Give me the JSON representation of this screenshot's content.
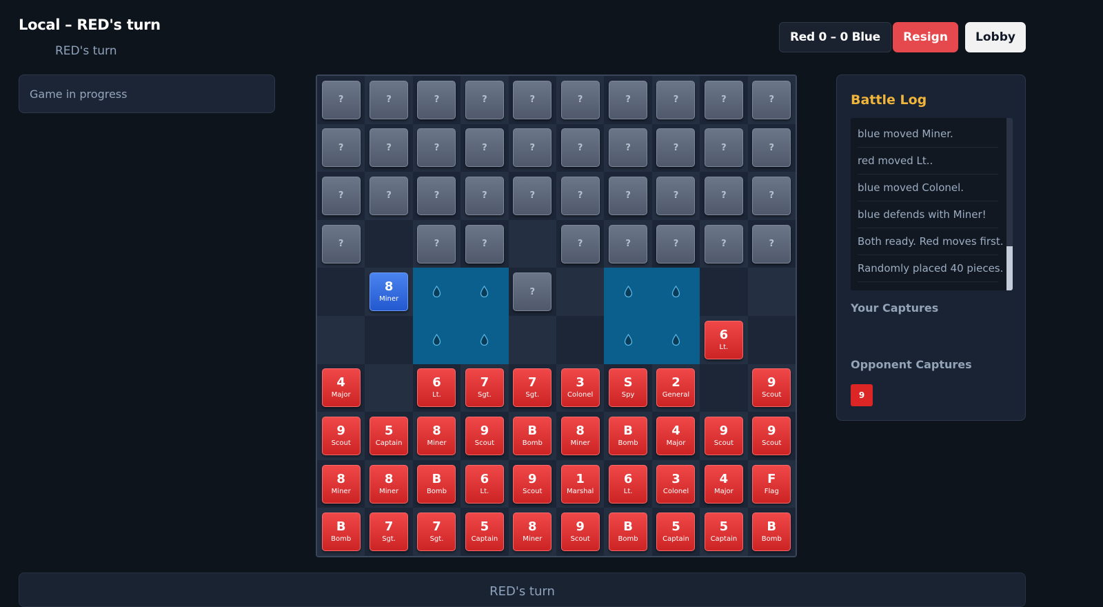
{
  "header": {
    "title": "Local – RED's turn",
    "subtitle": "RED's turn",
    "score": "Red 0 – 0 Blue",
    "resign_label": "Resign",
    "lobby_label": "Lobby"
  },
  "status": {
    "text": "Game in progress"
  },
  "colors": {
    "red_piece": "#e53935",
    "blue_piece": "#3b6fe0",
    "hidden_piece": "#5a6578",
    "lake": "#0b5f8c",
    "log_title": "#f0b53a",
    "resign": "#e5484d"
  },
  "board": {
    "hidden_label": "?",
    "lake_icon": "water-drop-icon",
    "rows": [
      [
        "?",
        "?",
        "?",
        "?",
        "?",
        "?",
        "?",
        "?",
        "?",
        "?"
      ],
      [
        "?",
        "?",
        "?",
        "?",
        "?",
        "?",
        "?",
        "?",
        "?",
        "?"
      ],
      [
        "?",
        "?",
        "?",
        "?",
        "?",
        "?",
        "?",
        "?",
        "?",
        "?"
      ],
      [
        "?",
        "",
        "?",
        "?",
        "",
        "?",
        "?",
        "?",
        "?",
        "?"
      ],
      [
        "",
        "B8",
        "~",
        "~",
        "?",
        "",
        "~",
        "~",
        "",
        ""
      ],
      [
        "",
        "",
        "~",
        "~",
        "",
        "",
        "~",
        "~",
        "R6",
        ""
      ],
      [
        "R4",
        "",
        "R6",
        "R7",
        "R7",
        "R3",
        "RS",
        "R2",
        "",
        "R9"
      ],
      [
        "R9",
        "R5",
        "R8",
        "R9",
        "RB",
        "R8",
        "RB",
        "R4",
        "R9",
        "R9"
      ],
      [
        "R8",
        "R8",
        "RB",
        "R6",
        "R9",
        "R1",
        "R6",
        "R3",
        "R4",
        "RF"
      ],
      [
        "RB",
        "R7",
        "R7",
        "R5",
        "R8",
        "R9",
        "RB",
        "R5",
        "R5",
        "RB"
      ]
    ],
    "rank_names": {
      "1": "Marshal",
      "2": "General",
      "3": "Colonel",
      "4": "Major",
      "5": "Captain",
      "6": "Lt.",
      "7": "Sgt.",
      "8": "Miner",
      "9": "Scout",
      "S": "Spy",
      "B": "Bomb",
      "F": "Flag"
    }
  },
  "battle_log": {
    "title": "Battle Log",
    "entries": [
      "blue moved Miner.",
      "red moved Lt..",
      "blue moved Colonel.",
      "blue defends with Miner!",
      "Both ready. Red moves first.",
      "Randomly placed 40 pieces."
    ]
  },
  "captures": {
    "yours_title": "Your Captures",
    "yours": [],
    "opponent_title": "Opponent Captures",
    "opponent": [
      "9"
    ]
  },
  "footer": {
    "text": "RED's turn"
  }
}
